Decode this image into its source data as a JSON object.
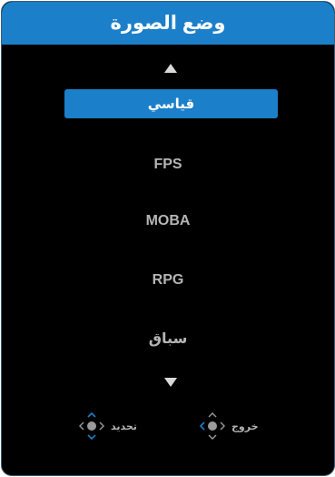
{
  "menu": {
    "title": "وضع الصورة",
    "items": [
      {
        "label": "قياسي",
        "selected": true
      },
      {
        "label": "FPS",
        "selected": false
      },
      {
        "label": "MOBA",
        "selected": false
      },
      {
        "label": "RPG",
        "selected": false
      },
      {
        "label": "سباق",
        "selected": false
      }
    ]
  },
  "hints": {
    "select_label": "تحديد",
    "exit_label": "خروج"
  },
  "icons": {
    "up": "triangle-up-icon",
    "down": "triangle-down-icon",
    "select": "joystick-up-down-icon",
    "exit": "joystick-left-icon"
  },
  "colors": {
    "accent": "#1c7fc9",
    "background": "#000000",
    "text": "#b5b5b5",
    "selected_text": "#ffffff"
  }
}
